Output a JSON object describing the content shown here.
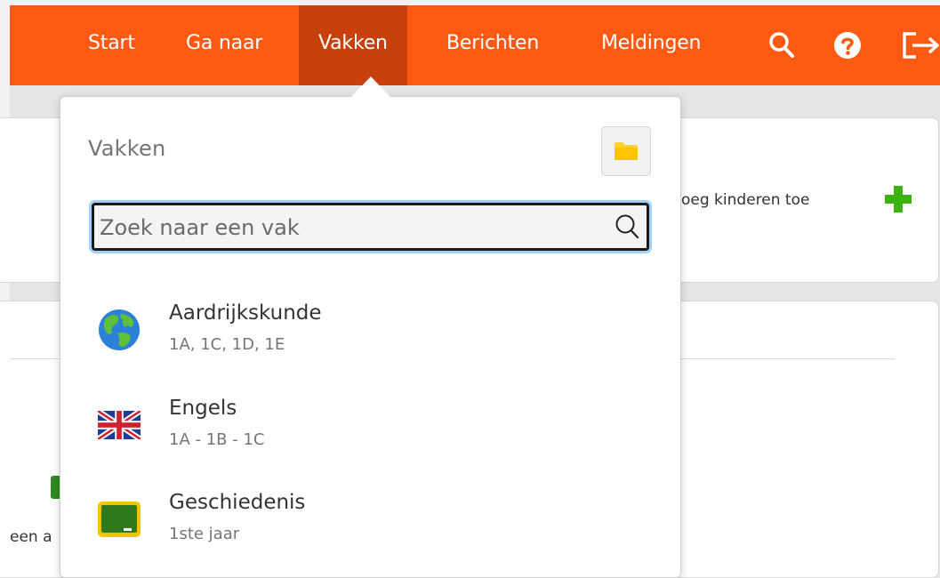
{
  "nav": {
    "items": [
      {
        "label": "Start"
      },
      {
        "label": "Ga naar"
      },
      {
        "label": "Vakken",
        "active": true
      },
      {
        "label": "Berichten"
      },
      {
        "label": "Meldingen"
      }
    ],
    "icons": [
      "search-icon",
      "help-icon",
      "logout-icon"
    ]
  },
  "background": {
    "add_children_text": "oeg kinderen toe",
    "partial_text": "een a"
  },
  "dropdown": {
    "title": "Vakken",
    "search": {
      "placeholder": "Zoek naar een vak",
      "value": ""
    },
    "courses": [
      {
        "name": "Aardrijkskunde",
        "classes": "1A, 1C, 1D, 1E",
        "icon": "globe-icon"
      },
      {
        "name": "Engels",
        "classes": "1A - 1B - 1C",
        "icon": "uk-flag-icon"
      },
      {
        "name": "Geschiedenis",
        "classes": "1ste jaar",
        "icon": "chalkboard-icon"
      }
    ]
  },
  "colors": {
    "header": "#ff5a14",
    "header_active": "#c8400c",
    "add_icon": "#3bb30f",
    "folder_icon": "#ffd22e"
  }
}
